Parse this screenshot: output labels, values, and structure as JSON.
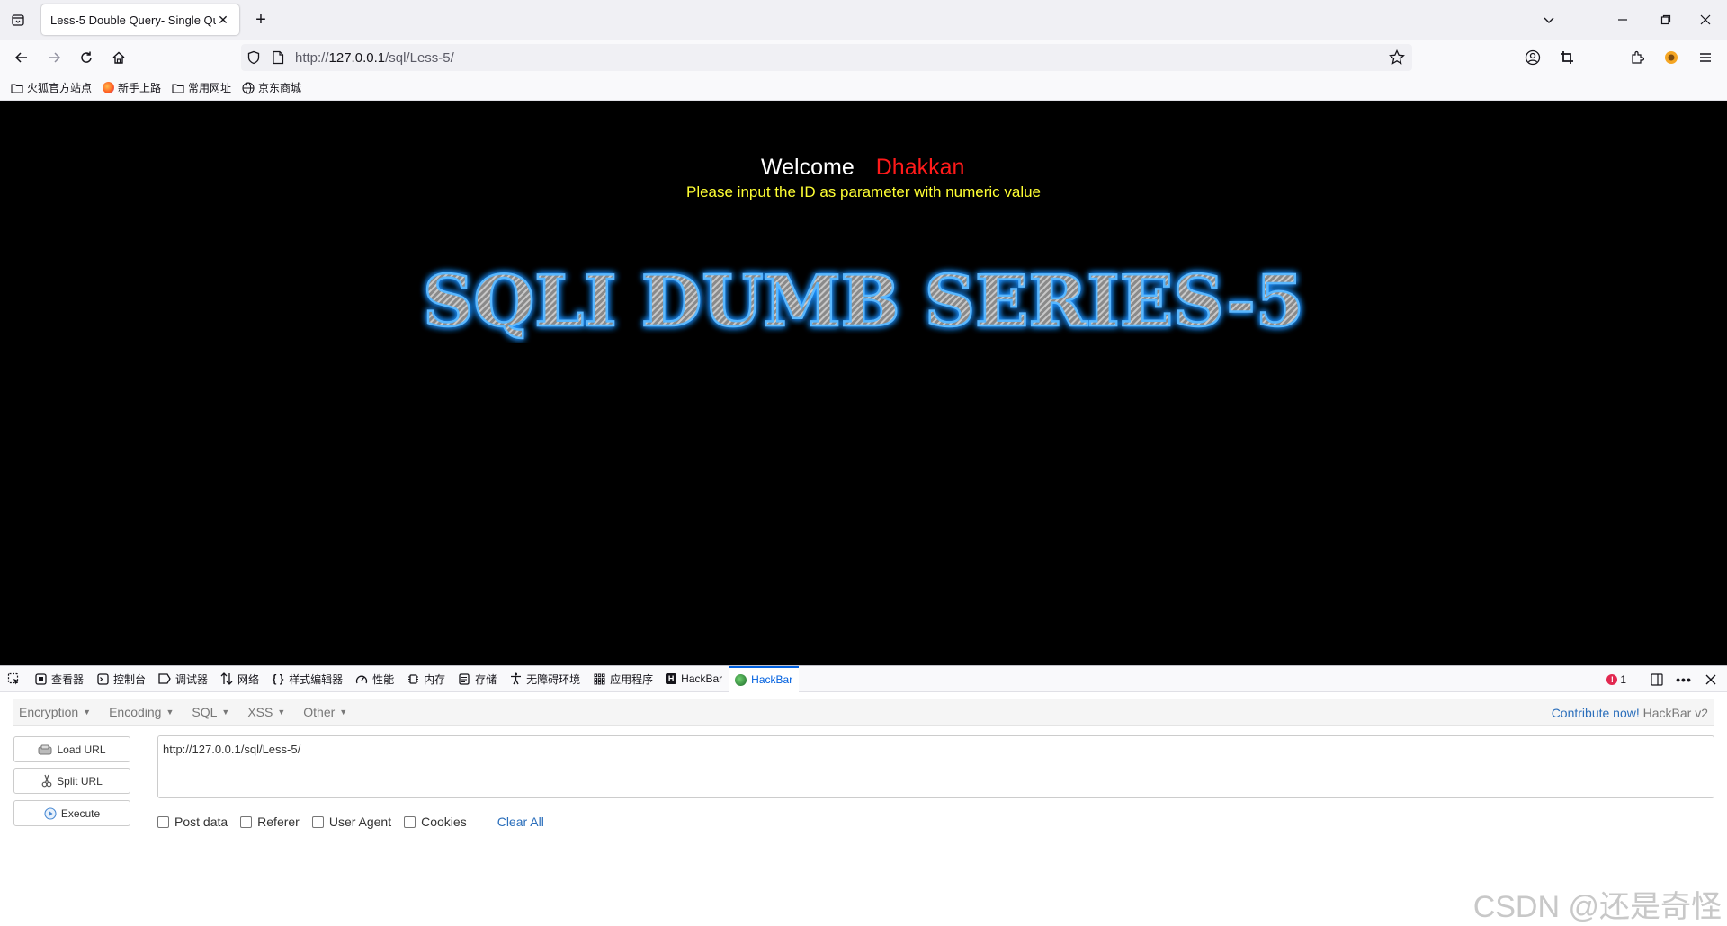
{
  "browser": {
    "tab_title": "Less-5 Double Query- Single Qu",
    "url_prefix": "http://",
    "url_host": "127.0.0.1",
    "url_path": "/sql/Less-5/",
    "bookmarks": [
      "火狐官方站点",
      "新手上路",
      "常用网址",
      "京东商城"
    ]
  },
  "page": {
    "welcome": "Welcome",
    "name": "Dhakkan",
    "prompt": "Please input the ID as parameter with numeric value",
    "banner": "SQLI DUMB SERIES-5",
    "colors": {
      "background": "#000000",
      "welcome": "#ffffff",
      "name": "#ff1a1a",
      "prompt": "#ffff33",
      "banner_glow": "#1e90ff"
    }
  },
  "devtools": {
    "tabs": [
      "查看器",
      "控制台",
      "调试器",
      "网络",
      "样式编辑器",
      "性能",
      "内存",
      "存储",
      "无障碍环境",
      "应用程序",
      "HackBar",
      "HackBar"
    ],
    "error_count": "1"
  },
  "hackbar": {
    "menu": [
      "Encryption",
      "Encoding",
      "SQL",
      "XSS",
      "Other"
    ],
    "contribute_link": "Contribute now!",
    "version": "HackBar v2",
    "load_url": "Load URL",
    "split_url": "Split URL",
    "execute": "Execute",
    "url_value": "http://127.0.0.1/sql/Less-5/",
    "options": [
      "Post data",
      "Referer",
      "User Agent",
      "Cookies"
    ],
    "clear_all": "Clear All"
  },
  "watermark": "CSDN @还是奇怪"
}
